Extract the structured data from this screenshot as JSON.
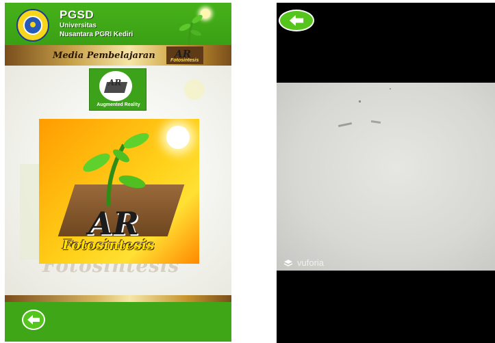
{
  "left_screen": {
    "header": {
      "org": "PGSD",
      "univ_line1": "Universitas",
      "univ_line2": "Nusantara PGRI Kediri",
      "media_title": "Media Pembelajaran",
      "mini_logo_title": "AR",
      "mini_logo_subtitle": "Fotosintesis"
    },
    "ar_button": {
      "logo_text": "AR",
      "label": "Augmented Reality"
    },
    "main_logo": {
      "title": "AR",
      "subtitle": "Fotosintesis"
    },
    "background_ghost_text": "Fotosintesis",
    "footer": {
      "back_icon": "arrow-left-icon"
    }
  },
  "right_screen": {
    "back_icon": "arrow-left-icon",
    "watermark": "vuforia",
    "watermark_icon": "vuforia-logo-icon"
  },
  "colors": {
    "primary_green": "#3ea617",
    "button_green": "#55c51e",
    "gold_band": "#c9a24a",
    "logo_orange": "#ff9c00",
    "logo_yellow": "#ffd11a"
  }
}
